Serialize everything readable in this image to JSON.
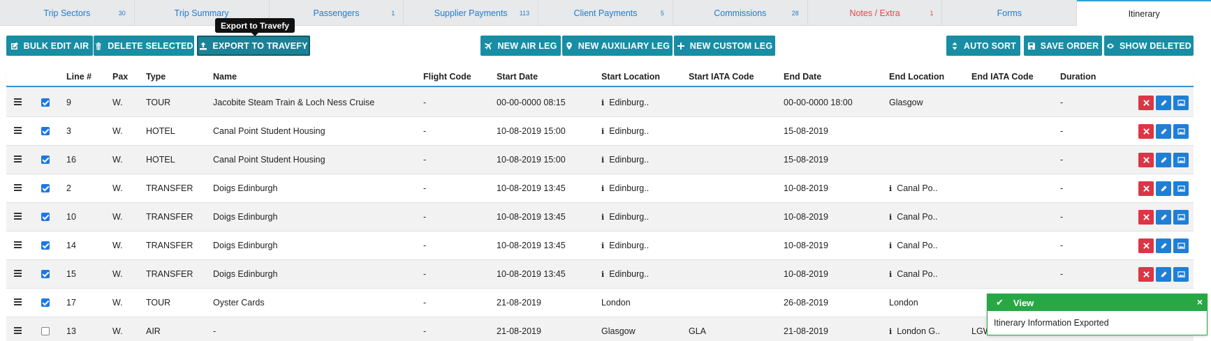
{
  "tabs": [
    {
      "label": "Trip Sectors",
      "badge": "30",
      "red": false,
      "active": false
    },
    {
      "label": "Trip Summary",
      "badge": "",
      "red": false,
      "active": false
    },
    {
      "label": "Passengers",
      "badge": "1",
      "red": false,
      "active": false
    },
    {
      "label": "Supplier Payments",
      "badge": "113",
      "red": false,
      "active": false
    },
    {
      "label": "Client Payments",
      "badge": "5",
      "red": false,
      "active": false
    },
    {
      "label": "Commissions",
      "badge": "28",
      "red": false,
      "active": false
    },
    {
      "label": "Notes / Extra",
      "badge": "1",
      "red": true,
      "active": false
    },
    {
      "label": "Forms",
      "badge": "",
      "red": false,
      "active": false
    },
    {
      "label": "Itinerary",
      "badge": "",
      "red": false,
      "active": true
    }
  ],
  "toolbar": {
    "bulk_edit_air": "BULK EDIT AIR",
    "delete_selected": "DELETE SELECTED",
    "export_to_travefy": "EXPORT TO TRAVEFY",
    "export_tooltip": "Export to Travefy",
    "new_air_leg": "NEW AIR LEG",
    "new_auxiliary_leg": "NEW AUXILIARY LEG",
    "new_custom_leg": "NEW CUSTOM LEG",
    "auto_sort": "AUTO SORT",
    "save_order": "SAVE ORDER",
    "show_deleted": "SHOW DELETED"
  },
  "table": {
    "columns": {
      "line": "Line #",
      "pax": "Pax",
      "type": "Type",
      "name": "Name",
      "flight_code": "Flight Code",
      "start_date": "Start Date",
      "start_location": "Start Location",
      "start_iata": "Start IATA Code",
      "end_date": "End Date",
      "end_location": "End Location",
      "end_iata": "End IATA Code",
      "duration": "Duration"
    },
    "rows": [
      {
        "checked": true,
        "line": "9",
        "pax": "W.",
        "type": "TOUR",
        "name": "Jacobite Steam Train & Loch Ness Cruise",
        "flight": "-",
        "start_date": "00-00-0000 08:15",
        "start_loc": "Edinburg..",
        "start_loc_info": true,
        "start_iata": "",
        "end_date": "00-00-0000 18:00",
        "end_loc": "Glasgow",
        "end_loc_info": false,
        "end_iata": "",
        "duration": "-",
        "actions": true
      },
      {
        "checked": true,
        "line": "3",
        "pax": "W.",
        "type": "HOTEL",
        "name": "Canal Point Student Housing",
        "flight": "-",
        "start_date": "10-08-2019 15:00",
        "start_loc": "Edinburg..",
        "start_loc_info": true,
        "start_iata": "",
        "end_date": "15-08-2019",
        "end_loc": "",
        "end_loc_info": false,
        "end_iata": "",
        "duration": "-",
        "actions": true
      },
      {
        "checked": true,
        "line": "16",
        "pax": "W.",
        "type": "HOTEL",
        "name": "Canal Point Student Housing",
        "flight": "-",
        "start_date": "10-08-2019 15:00",
        "start_loc": "Edinburg..",
        "start_loc_info": true,
        "start_iata": "",
        "end_date": "15-08-2019",
        "end_loc": "",
        "end_loc_info": false,
        "end_iata": "",
        "duration": "-",
        "actions": true
      },
      {
        "checked": true,
        "line": "2",
        "pax": "W.",
        "type": "TRANSFER",
        "name": "Doigs Edinburgh",
        "flight": "-",
        "start_date": "10-08-2019 13:45",
        "start_loc": "Edinburg..",
        "start_loc_info": true,
        "start_iata": "",
        "end_date": "10-08-2019",
        "end_loc": "Canal Po..",
        "end_loc_info": true,
        "end_iata": "",
        "duration": "-",
        "actions": true
      },
      {
        "checked": true,
        "line": "10",
        "pax": "W.",
        "type": "TRANSFER",
        "name": "Doigs Edinburgh",
        "flight": "-",
        "start_date": "10-08-2019 13:45",
        "start_loc": "Edinburg..",
        "start_loc_info": true,
        "start_iata": "",
        "end_date": "10-08-2019",
        "end_loc": "Canal Po..",
        "end_loc_info": true,
        "end_iata": "",
        "duration": "-",
        "actions": true
      },
      {
        "checked": true,
        "line": "14",
        "pax": "W.",
        "type": "TRANSFER",
        "name": "Doigs Edinburgh",
        "flight": "-",
        "start_date": "10-08-2019 13:45",
        "start_loc": "Edinburg..",
        "start_loc_info": true,
        "start_iata": "",
        "end_date": "10-08-2019",
        "end_loc": "Canal Po..",
        "end_loc_info": true,
        "end_iata": "",
        "duration": "-",
        "actions": true
      },
      {
        "checked": true,
        "line": "15",
        "pax": "W.",
        "type": "TRANSFER",
        "name": "Doigs Edinburgh",
        "flight": "-",
        "start_date": "10-08-2019 13:45",
        "start_loc": "Edinburg..",
        "start_loc_info": true,
        "start_iata": "",
        "end_date": "10-08-2019",
        "end_loc": "Canal Po..",
        "end_loc_info": true,
        "end_iata": "",
        "duration": "-",
        "actions": true
      },
      {
        "checked": true,
        "line": "17",
        "pax": "W.",
        "type": "TOUR",
        "name": "Oyster Cards",
        "flight": "-",
        "start_date": "21-08-2019",
        "start_loc": "London",
        "start_loc_info": false,
        "start_iata": "",
        "end_date": "26-08-2019",
        "end_loc": "London",
        "end_loc_info": false,
        "end_iata": "",
        "duration": "",
        "actions": false
      },
      {
        "checked": false,
        "line": "13",
        "pax": "W.",
        "type": "AIR",
        "name": "-",
        "flight": "-",
        "start_date": "21-08-2019",
        "start_loc": "Glasgow",
        "start_loc_info": false,
        "start_iata": "GLA",
        "end_date": "21-08-2019",
        "end_loc": "London G..",
        "end_loc_info": true,
        "end_iata": "LGW",
        "duration": "",
        "actions": false
      }
    ]
  },
  "toast": {
    "title": "View",
    "message": "Itinerary Information Exported",
    "close": "×"
  },
  "colors": {
    "primary_button": "#178ea3",
    "tab_link": "#1f7bd0",
    "danger": "#dc3545",
    "success": "#28a745"
  }
}
